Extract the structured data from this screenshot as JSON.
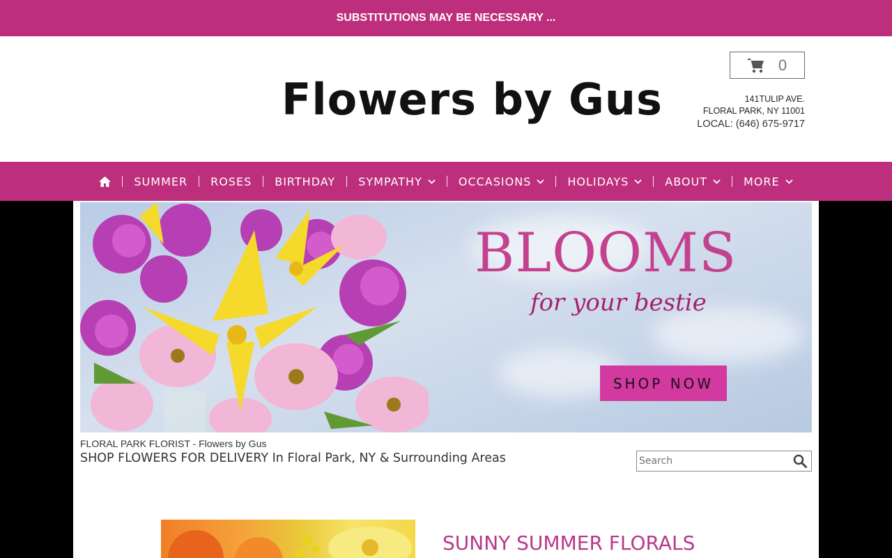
{
  "announcement": "SUBSTITUTIONS MAY BE NECESSARY ...",
  "header": {
    "logo": "Flowers by Gus",
    "cart_count": "0",
    "address_line1": "141TULIP AVE.",
    "address_line2": "FLORAL PARK, NY 11001",
    "phone": "LOCAL: (646) 675-9717"
  },
  "nav": {
    "items": [
      {
        "label": "SUMMER"
      },
      {
        "label": "ROSES"
      },
      {
        "label": "BIRTHDAY"
      },
      {
        "label": "SYMPATHY"
      },
      {
        "label": "OCCASIONS"
      },
      {
        "label": "HOLIDAYS"
      },
      {
        "label": "ABOUT"
      },
      {
        "label": "MORE"
      }
    ]
  },
  "banner": {
    "headline": "BLOOMS",
    "subheadline": "for your bestie",
    "cta": "SHOP NOW"
  },
  "intro": {
    "florist_line": "FLORAL PARK FLORIST - Flowers by Gus",
    "shop_line": "SHOP FLOWERS FOR DELIVERY In Floral Park, NY & Surrounding Areas"
  },
  "search": {
    "placeholder": "Search"
  },
  "featured": {
    "title": "SUNNY SUMMER FLORALS"
  },
  "colors": {
    "brand": "#bd2f7c",
    "accent": "#d23aa0",
    "title": "#b9378a"
  }
}
